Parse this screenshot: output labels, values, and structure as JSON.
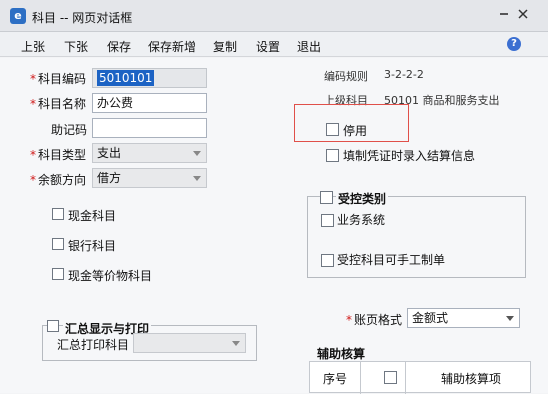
{
  "window": {
    "title": "科目 -- 网页对话框"
  },
  "menu": [
    "上张",
    "下张",
    "保存",
    "保存新增",
    "复制",
    "设置",
    "退出"
  ],
  "form": {
    "code_label": "科目编码",
    "code_value": "5010101",
    "name_label": "科目名称",
    "name_value": "办公费",
    "mnemonic_label": "助记码",
    "mnemonic_value": "",
    "type_label": "科目类型",
    "type_value": "支出",
    "balance_label": "余额方向",
    "balance_value": "借方",
    "rule_label": "编码规则",
    "rule_value": "3-2-2-2",
    "parent_label": "上级科目",
    "parent_value": "50101 商品和服务支出"
  },
  "checkboxes": {
    "cash": "现金科目",
    "bank": "银行科目",
    "cash_equiv": "现金等价物科目",
    "disable": "停用",
    "voucher": "填制凭证时录入结算信息"
  },
  "controlled": {
    "title": "受控类别",
    "business": "业务系统",
    "manual": "受控科目可手工制单"
  },
  "summary": {
    "title": "汇总显示与打印",
    "print_label": "汇总打印科目",
    "print_value": ""
  },
  "ledger": {
    "label": "账页格式",
    "value": "金额式"
  },
  "aux": {
    "title": "辅助核算",
    "col_seq": "序号",
    "col_item": "辅助核算项"
  },
  "colors": {
    "selection": "#1c63c4",
    "required": "#d01818",
    "highlight_box": "#e0504a"
  },
  "icons": [
    "app-icon",
    "minimize-icon",
    "close-icon",
    "help-icon",
    "dropdown-arrow-icon"
  ]
}
